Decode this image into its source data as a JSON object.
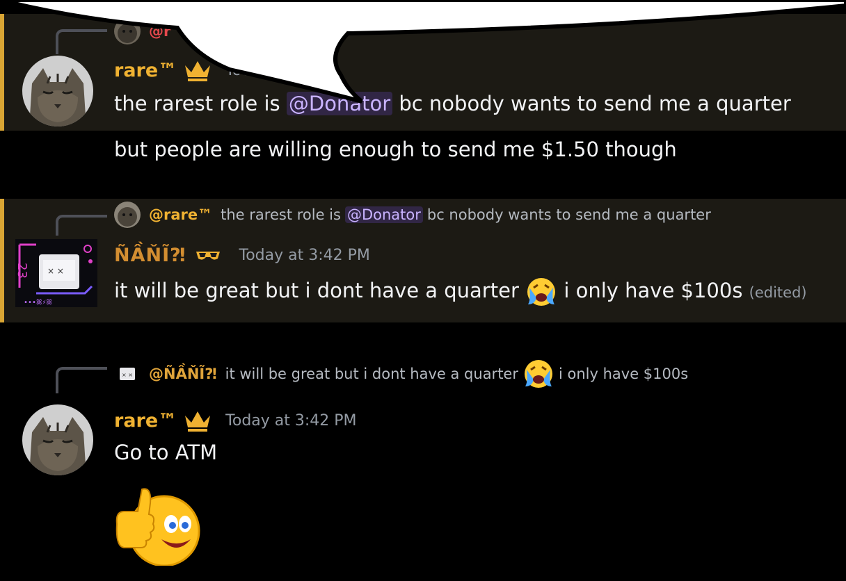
{
  "messages": [
    {
      "reply": {
        "author": "@r"
      },
      "author": "rare™",
      "time": "Tod",
      "text_before": "the rarest role is ",
      "mention": "@Donator",
      "text_after": " bc nobody wants to send me a quarter",
      "followup": "but people are willing enough to send me $1.50 though"
    },
    {
      "reply": {
        "author": "@rare™",
        "text_before": "the rarest role is",
        "mention": "@Donator",
        "text_after": "bc nobody wants to send me a quarter"
      },
      "author": "ÑẦŇĨ⁈",
      "time": "Today at 3:42 PM",
      "text_before": "it will be great but i dont have a quarter",
      "text_after": "i only have $100s",
      "edited": "(edited)"
    },
    {
      "reply": {
        "author": "@ÑẦŇĨ⁈",
        "text_before": "it will be great but i dont have a quarter",
        "text_after": "i only have $100s"
      },
      "author": "rare™",
      "time": "Today at 3:42 PM",
      "text": "Go to ATM"
    }
  ],
  "colors": {
    "background": "#000000",
    "highlight": "#1c1a14",
    "highlight_bar": "#d9a534",
    "username_gold": "#f0b232",
    "username_orange": "#d38e31",
    "mention": "#c9b3ff",
    "timestamp": "#949ba4"
  },
  "icons": [
    "crown-icon",
    "sunglasses-icon",
    "crying-emoji-icon",
    "thumbs-up-emoji-icon",
    "cat-avatar",
    "robot-avatar"
  ]
}
